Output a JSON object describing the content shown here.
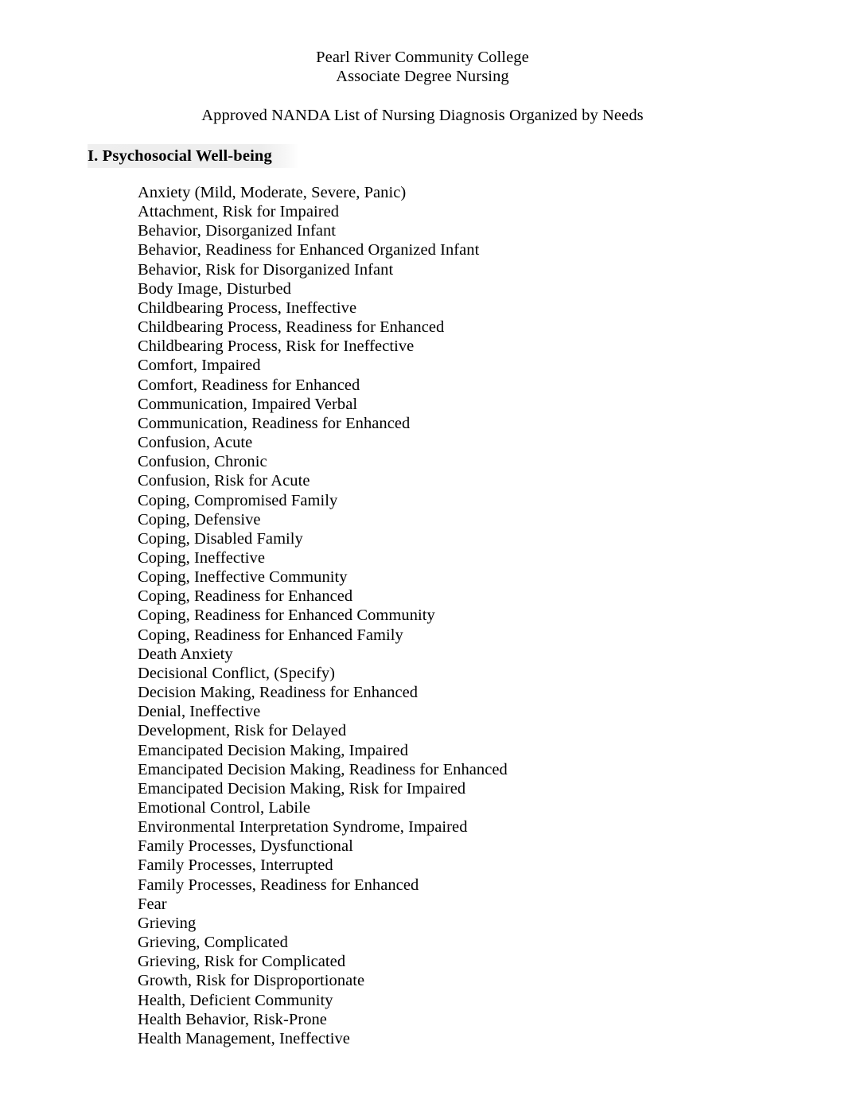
{
  "header": {
    "institution": "Pearl River Community College",
    "program": "Associate Degree Nursing",
    "document_title": "Approved NANDA List of Nursing Diagnosis Organized by Needs"
  },
  "section": {
    "number_and_title": "I. Psychosocial Well-being",
    "highlight_color": "#ededed"
  },
  "diagnoses": [
    "Anxiety (Mild, Moderate, Severe, Panic)",
    "Attachment, Risk for Impaired",
    "Behavior, Disorganized Infant",
    "Behavior, Readiness for Enhanced Organized Infant",
    "Behavior, Risk for Disorganized Infant",
    "Body Image, Disturbed",
    "Childbearing Process, Ineffective",
    "Childbearing Process, Readiness for Enhanced",
    "Childbearing Process, Risk for Ineffective",
    "Comfort, Impaired",
    "Comfort, Readiness for Enhanced",
    "Communication, Impaired Verbal",
    "Communication, Readiness for Enhanced",
    "Confusion, Acute",
    "Confusion, Chronic",
    "Confusion, Risk for Acute",
    "Coping, Compromised Family",
    "Coping, Defensive",
    "Coping, Disabled Family",
    "Coping, Ineffective",
    "Coping, Ineffective Community",
    "Coping, Readiness for Enhanced",
    "Coping, Readiness for Enhanced Community",
    "Coping, Readiness for Enhanced Family",
    "Death Anxiety",
    "Decisional Conflict, (Specify)",
    "Decision Making, Readiness for Enhanced",
    "Denial, Ineffective",
    "Development, Risk for Delayed",
    "Emancipated Decision Making, Impaired",
    "Emancipated Decision Making, Readiness for Enhanced",
    "Emancipated Decision Making, Risk for Impaired",
    "Emotional Control, Labile",
    "Environmental Interpretation Syndrome, Impaired",
    "Family Processes, Dysfunctional",
    "Family Processes, Interrupted",
    "Family Processes, Readiness for Enhanced",
    "Fear",
    "Grieving",
    "Grieving, Complicated",
    "Grieving, Risk for Complicated",
    "Growth, Risk for Disproportionate",
    "Health, Deficient Community",
    "Health Behavior, Risk-Prone",
    "Health Management, Ineffective"
  ]
}
